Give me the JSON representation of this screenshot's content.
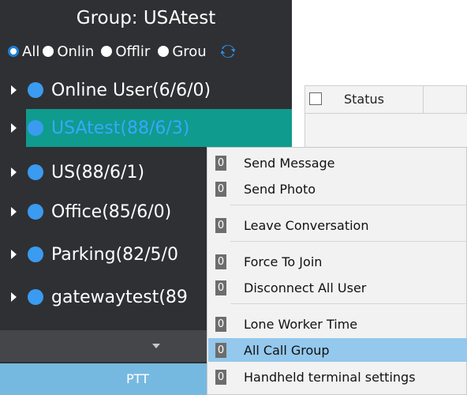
{
  "sidebar": {
    "group_title": "Group:  USAtest",
    "filters": [
      {
        "label": "All",
        "selected": true
      },
      {
        "label": "Onlin",
        "selected": false
      },
      {
        "label": "Offlir",
        "selected": false
      },
      {
        "label": "Grou",
        "selected": false
      }
    ],
    "refresh_icon": "refresh-icon",
    "groups": [
      {
        "label": "Online User(6/6/0)"
      },
      {
        "label": "USAtest(88/6/3)"
      },
      {
        "label": "US(88/6/1)"
      },
      {
        "label": "Office(85/6/0)"
      },
      {
        "label": "Parking(82/5/0"
      },
      {
        "label": "gatewaytest(89"
      }
    ],
    "ptt_label": "PTT"
  },
  "table": {
    "header_status": "Status"
  },
  "context_menu": {
    "items": [
      {
        "badge": "0",
        "label": "Send Message"
      },
      {
        "badge": "0",
        "label": "Send Photo"
      },
      {
        "badge": "0",
        "label": "Leave Conversation"
      },
      {
        "badge": "0",
        "label": "Force To Join"
      },
      {
        "badge": "0",
        "label": "Disconnect All User"
      },
      {
        "badge": "0",
        "label": "Lone Worker Time"
      },
      {
        "badge": "0",
        "label": "All Call Group"
      },
      {
        "badge": "0",
        "label": "Handheld terminal settings"
      }
    ]
  },
  "colors": {
    "sidebar_bg": "#2f3033",
    "selected_row": "#0f9b8e",
    "dot_blue": "#3a9bf0",
    "menu_highlight": "#94c8ec",
    "ptt_bar": "#76b9e0"
  }
}
